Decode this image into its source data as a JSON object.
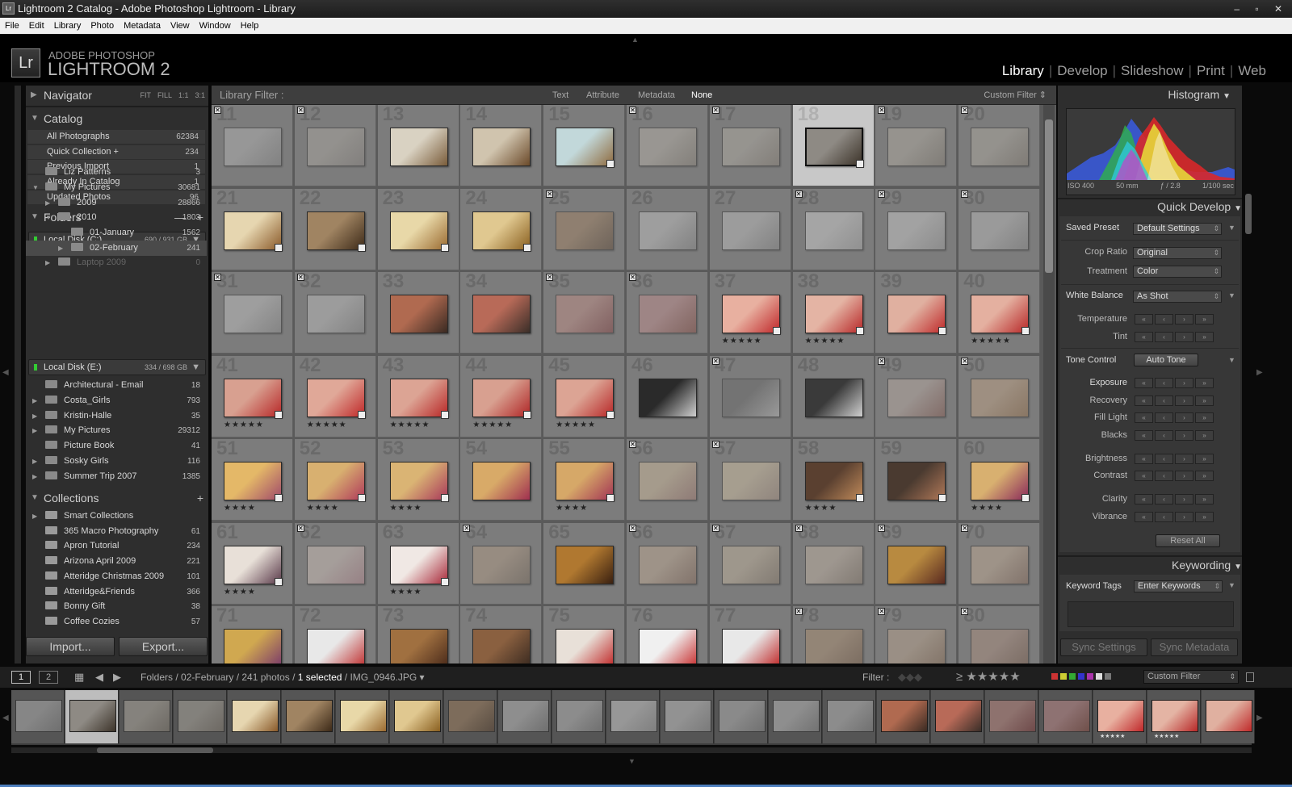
{
  "window": {
    "title": "Lightroom 2 Catalog - Adobe Photoshop Lightroom - Library",
    "app_icon": "Lr",
    "controls": "– ▫ ✕"
  },
  "menubar": [
    "File",
    "Edit",
    "Library",
    "Photo",
    "Metadata",
    "View",
    "Window",
    "Help"
  ],
  "brand": {
    "logo": "Lr",
    "line1": "ADOBE PHOTOSHOP",
    "line2": "LIGHTROOM 2"
  },
  "modules": [
    "Library",
    "Develop",
    "Slideshow",
    "Print",
    "Web"
  ],
  "active_module": "Library",
  "navigator": {
    "title": "Navigator",
    "zoom_options": [
      "FIT",
      "FILL",
      "1:1",
      "3:1"
    ]
  },
  "catalog": {
    "title": "Catalog",
    "items": [
      {
        "label": "All Photographs",
        "count": "62384"
      },
      {
        "label": "Quick Collection +",
        "count": "234"
      },
      {
        "label": "Previous Import",
        "count": "1"
      },
      {
        "label": "Already In Catalog",
        "count": "1"
      },
      {
        "label": "Updated Photos",
        "count": "96"
      }
    ]
  },
  "folders": {
    "title": "Folders",
    "disk_c": {
      "label": "Local Disk (C:)",
      "size": "690 / 931 GB"
    },
    "tree_c": [
      {
        "label": "Liz Patterns",
        "count": "3"
      },
      {
        "label": "My Pictures",
        "count": "30681"
      },
      {
        "label": "2009",
        "count": "28866"
      },
      {
        "label": "2010",
        "count": "1803"
      },
      {
        "label": "01-January",
        "count": "1562"
      },
      {
        "label": "02-February",
        "count": "241"
      },
      {
        "label": "Laptop 2009",
        "count": "0"
      }
    ],
    "disk_e": {
      "label": "Local Disk (E:)",
      "size": "334 / 698 GB"
    },
    "tree_e": [
      {
        "label": "Architectural - Email",
        "count": "18"
      },
      {
        "label": "Costa_Girls",
        "count": "793"
      },
      {
        "label": "Kristin-Halle",
        "count": "35"
      },
      {
        "label": "My Pictures",
        "count": "29312"
      },
      {
        "label": "Picture Book",
        "count": "41"
      },
      {
        "label": "Sosky Girls",
        "count": "116"
      },
      {
        "label": "Summer Trip 2007",
        "count": "1385"
      }
    ]
  },
  "collections": {
    "title": "Collections",
    "items": [
      {
        "label": "Smart Collections",
        "count": ""
      },
      {
        "label": "365 Macro Photography",
        "count": "61"
      },
      {
        "label": "Apron Tutorial",
        "count": "234"
      },
      {
        "label": "Arizona April 2009",
        "count": "221"
      },
      {
        "label": "Atteridge Christmas 2009",
        "count": "101"
      },
      {
        "label": "Atteridge&Friends",
        "count": "366"
      },
      {
        "label": "Bonny Gift",
        "count": "38"
      },
      {
        "label": "Coffee Cozies",
        "count": "57"
      }
    ]
  },
  "left_buttons": {
    "import": "Import...",
    "export": "Export..."
  },
  "library_filter": {
    "label": "Library Filter :",
    "options": [
      "Text",
      "Attribute",
      "Metadata",
      "None"
    ],
    "active": "None",
    "preset": "Custom Filter ⇕"
  },
  "grid": {
    "start_number": 11,
    "selected_number": 18,
    "dim_numbers": [
      11,
      12,
      16,
      17,
      19,
      20,
      25,
      26,
      27,
      28,
      29,
      30,
      31,
      32,
      35,
      36,
      47,
      49,
      50,
      56,
      57,
      62,
      64,
      66,
      67,
      68,
      70,
      78,
      79,
      80
    ],
    "flagged_numbers": [
      11,
      12,
      16,
      17,
      19,
      20,
      25,
      28,
      29,
      30,
      31,
      32,
      35,
      36,
      47,
      49,
      50,
      56,
      57,
      62,
      64,
      66,
      67,
      68,
      69,
      70,
      78,
      79,
      80
    ],
    "stars": {
      "37": "★★★★★",
      "38": "★★★★★",
      "40": "★★★★★",
      "41": "★★★★★",
      "42": "★★★★★",
      "43": "★★★★★",
      "44": "★★★★★",
      "45": "★★★★★",
      "51": "★★★★",
      "52": "★★★★",
      "53": "★★★★",
      "55": "★★★★",
      "58": "★★★★",
      "60": "★★★★",
      "61": "★★★★",
      "63": "★★★★"
    },
    "badged_numbers": [
      15,
      18,
      21,
      22,
      23,
      24,
      37,
      38,
      39,
      40,
      41,
      42,
      43,
      44,
      45,
      51,
      52,
      53,
      55,
      58,
      59,
      60,
      61,
      63
    ]
  },
  "thumb_colors": {
    "11": [
      "#b8b8b8",
      "#8a8a8a"
    ],
    "12": [
      "#b0aca4",
      "#8a8480"
    ],
    "13": [
      "#d9d2c2",
      "#7a5c3a"
    ],
    "14": [
      "#d0c4ae",
      "#6b4a2a"
    ],
    "15": [
      "#c2d8da",
      "#8f6b3f"
    ],
    "16": [
      "#bdb7ad",
      "#8d857a"
    ],
    "17": [
      "#b6b1a8",
      "#8b8276"
    ],
    "18": [
      "#8e8a84",
      "#3d342a"
    ],
    "19": [
      "#b6b0a5",
      "#867e72"
    ],
    "20": [
      "#b2ada3",
      "#857c70"
    ],
    "21": [
      "#e6d6b0",
      "#8a5a2a"
    ],
    "22": [
      "#a08462",
      "#3d2a18"
    ],
    "23": [
      "#e8d8a8",
      "#9a6a30"
    ],
    "24": [
      "#e0c890",
      "#8a6020"
    ],
    "25": [
      "#a68462",
      "#5e4632"
    ],
    "26": [
      "#c8c8c8",
      "#8a8a8a"
    ],
    "27": [
      "#c4c4c4",
      "#8a8a8a"
    ],
    "28": [
      "#d8d8d8",
      "#aaaaaa"
    ],
    "29": [
      "#d0d0d0",
      "#a0a0a0"
    ],
    "30": [
      "#c0c0c0",
      "#8c8c8c"
    ],
    "31": [
      "#c8c8c8",
      "#909090"
    ],
    "32": [
      "#c4c4c4",
      "#8c8c8c"
    ],
    "33": [
      "#b06a50",
      "#3a2a22"
    ],
    "34": [
      "#b86a58",
      "#3a2e28"
    ],
    "35": [
      "#c89088",
      "#884040"
    ],
    "36": [
      "#c89090",
      "#8a4a40"
    ],
    "37": [
      "#e8b0a0",
      "#c0282a"
    ],
    "38": [
      "#e4b4a4",
      "#b82828"
    ],
    "39": [
      "#e0b0a0",
      "#c02a2a"
    ],
    "40": [
      "#e4b0a0",
      "#b82828"
    ],
    "41": [
      "#d8a090",
      "#b82828"
    ],
    "42": [
      "#e0a898",
      "#c02828"
    ],
    "43": [
      "#dca494",
      "#b82626"
    ],
    "44": [
      "#d8a090",
      "#b02626"
    ],
    "45": [
      "#dca494",
      "#b82828"
    ],
    "46": [
      "#2a2a2a",
      "#cfcfcf"
    ],
    "47": [
      "#6a6a6a",
      "#bdbdbd"
    ],
    "48": [
      "#3a3a3a",
      "#d0d0d0"
    ],
    "49": [
      "#c0b0a8",
      "#8a5a50"
    ],
    "50": [
      "#c8a888",
      "#9a7048"
    ],
    "51": [
      "#e4b868",
      "#a04a6a"
    ],
    "52": [
      "#d8b070",
      "#b03a5a"
    ],
    "53": [
      "#dab474",
      "#a8385a"
    ],
    "54": [
      "#d8aa68",
      "#a03050"
    ],
    "55": [
      "#d6a868",
      "#a23454"
    ],
    "56": [
      "#d8c2a0",
      "#a67a70"
    ],
    "57": [
      "#dac8a8",
      "#a89080"
    ],
    "58": [
      "#5a4030",
      "#c08a5a"
    ],
    "59": [
      "#4a3a30",
      "#b07858"
    ],
    "60": [
      "#d8b070",
      "#8a2a5a"
    ],
    "61": [
      "#e8e0d8",
      "#5a3a4a"
    ],
    "62": [
      "#d8c8c0",
      "#b88890"
    ],
    "63": [
      "#f0e8e4",
      "#a82838"
    ],
    "64": [
      "#b8a088",
      "#7a6a5a"
    ],
    "65": [
      "#b07830",
      "#3a2010"
    ],
    "66": [
      "#c8b098",
      "#8a6a58"
    ],
    "67": [
      "#c8b8a0",
      "#8a7a68"
    ],
    "68": [
      "#c8b8a8",
      "#8a7a6a"
    ],
    "69": [
      "#b88a40",
      "#5a2a20"
    ],
    "70": [
      "#c8b098",
      "#8a6a58"
    ],
    "71": [
      "#d0a850",
      "#7a3a6a"
    ],
    "72": [
      "#e8e8e8",
      "#c03030"
    ],
    "73": [
      "#a07040",
      "#4a2a1a"
    ],
    "74": [
      "#8a6040",
      "#3a2a20"
    ],
    "75": [
      "#e8e0d8",
      "#c02828"
    ],
    "76": [
      "#f0f0f0",
      "#c83030"
    ],
    "77": [
      "#e8e8e8",
      "#c02828"
    ],
    "78": [
      "#b09070",
      "#7a5a40"
    ],
    "79": [
      "#c0a890",
      "#8a6a50"
    ],
    "80": [
      "#b09080",
      "#7a5a48"
    ]
  },
  "right": {
    "histogram": {
      "title": "Histogram",
      "iso": "ISO 400",
      "focal": "50 mm",
      "aperture": "ƒ / 2.8",
      "shutter": "1/100 sec"
    },
    "quick_develop": {
      "title": "Quick Develop",
      "saved_preset_label": "Saved Preset",
      "saved_preset_value": "Default Settings",
      "crop_label": "Crop Ratio",
      "crop_value": "Original",
      "treatment_label": "Treatment",
      "treatment_value": "Color",
      "wb_label": "White Balance",
      "wb_value": "As Shot",
      "temp_label": "Temperature",
      "tint_label": "Tint",
      "tone_label": "Tone Control",
      "auto_tone": "Auto Tone",
      "exposure": "Exposure",
      "recovery": "Recovery",
      "fill": "Fill Light",
      "blacks": "Blacks",
      "brightness": "Brightness",
      "contrast": "Contrast",
      "clarity": "Clarity",
      "vibrance": "Vibrance",
      "reset": "Reset All"
    },
    "keywording": {
      "title": "Keywording",
      "tags_label": "Keyword Tags",
      "tags_value": "Enter Keywords"
    },
    "sync_settings": "Sync Settings",
    "sync_metadata": "Sync Metadata"
  },
  "filmstrip_bar": {
    "view1": "1",
    "view2": "2",
    "path_prefix": "Folders / 02-February / 241 photos / ",
    "selected": "1 selected",
    "file": " / IMG_0946.JPG ▾",
    "filter_label": "Filter :",
    "filter_preset": "Custom Filter",
    "stars": "≥ ★★★★★"
  },
  "filmstrip": [
    {
      "c": [
        "#b8b8b8",
        "#8a8a8a"
      ],
      "dim": true
    },
    {
      "c": [
        "#8e8a84",
        "#3d342a"
      ],
      "sel": true
    },
    {
      "c": [
        "#b6b0a5",
        "#867e72"
      ],
      "dim": true
    },
    {
      "c": [
        "#b2ada3",
        "#857c70"
      ],
      "dim": true
    },
    {
      "c": [
        "#e6d6b0",
        "#8a5a2a"
      ]
    },
    {
      "c": [
        "#a08462",
        "#3d2a18"
      ]
    },
    {
      "c": [
        "#e8d8a8",
        "#9a6a30"
      ]
    },
    {
      "c": [
        "#e0c890",
        "#8a6020"
      ]
    },
    {
      "c": [
        "#a68462",
        "#5e4632"
      ],
      "dim": true
    },
    {
      "c": [
        "#c8c8c8",
        "#8a8a8a"
      ],
      "dim": true
    },
    {
      "c": [
        "#c4c4c4",
        "#8a8a8a"
      ],
      "dim": true
    },
    {
      "c": [
        "#d8d8d8",
        "#aaaaaa"
      ],
      "dim": true
    },
    {
      "c": [
        "#d0d0d0",
        "#a0a0a0"
      ],
      "dim": true
    },
    {
      "c": [
        "#c0c0c0",
        "#8c8c8c"
      ],
      "dim": true
    },
    {
      "c": [
        "#c8c8c8",
        "#909090"
      ],
      "dim": true
    },
    {
      "c": [
        "#c4c4c4",
        "#8c8c8c"
      ],
      "dim": true
    },
    {
      "c": [
        "#b06a50",
        "#3a2a22"
      ]
    },
    {
      "c": [
        "#b86a58",
        "#3a2e28"
      ]
    },
    {
      "c": [
        "#c89088",
        "#884040"
      ],
      "dim": true
    },
    {
      "c": [
        "#c89090",
        "#8a4a40"
      ],
      "dim": true
    },
    {
      "c": [
        "#e8b0a0",
        "#c0282a"
      ],
      "st": "★★★★★"
    },
    {
      "c": [
        "#e4b4a4",
        "#b82828"
      ],
      "st": "★★★★★"
    },
    {
      "c": [
        "#e0b0a0",
        "#c02a2a"
      ]
    }
  ]
}
